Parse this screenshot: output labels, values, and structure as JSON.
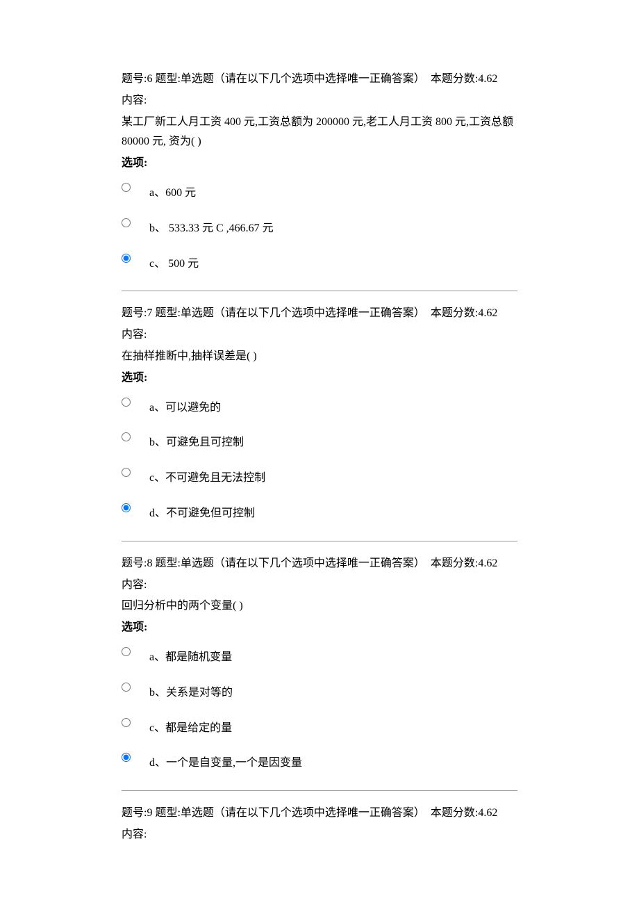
{
  "questions": [
    {
      "number": "6",
      "type_label": "题型:单选题（请在以下几个选项中选择唯一正确答案）",
      "score_label": "本题分数:4.62",
      "content_label": "内容:",
      "content": "某工厂新工人月工资 400 元,工资总额为 200000 元,老工人月工资 800 元,工资总额 80000 元, 资为( )",
      "options_label": "选项:",
      "options": [
        {
          "text": "a、600 元",
          "selected": false
        },
        {
          "text": "b、 533.33 元 C ,466.67 元",
          "selected": false
        },
        {
          "text": "c、 500 元",
          "selected": true
        }
      ]
    },
    {
      "number": "7",
      "type_label": "题型:单选题（请在以下几个选项中选择唯一正确答案）",
      "score_label": "本题分数:4.62",
      "content_label": "内容:",
      "content": "在抽样推断中,抽样误差是( )",
      "options_label": "选项:",
      "options": [
        {
          "text": "a、可以避免的",
          "selected": false
        },
        {
          "text": "b、可避免且可控制",
          "selected": false
        },
        {
          "text": "c、不可避免且无法控制",
          "selected": false
        },
        {
          "text": "d、不可避免但可控制",
          "selected": true
        }
      ]
    },
    {
      "number": "8",
      "type_label": "题型:单选题（请在以下几个选项中选择唯一正确答案）",
      "score_label": "本题分数:4.62",
      "content_label": "内容:",
      "content": "回归分析中的两个变量( )",
      "options_label": "选项:",
      "options": [
        {
          "text": "a、都是随机变量",
          "selected": false
        },
        {
          "text": "b、关系是对等的",
          "selected": false
        },
        {
          "text": "c、都是给定的量",
          "selected": false
        },
        {
          "text": "d、一个是自变量,一个是因变量",
          "selected": true
        }
      ]
    },
    {
      "number": "9",
      "type_label": "题型:单选题（请在以下几个选项中选择唯一正确答案）",
      "score_label": "本题分数:4.62",
      "content_label": "内容:",
      "content": "",
      "options_label": "",
      "options": []
    }
  ],
  "labels": {
    "number_prefix": "题号:"
  }
}
